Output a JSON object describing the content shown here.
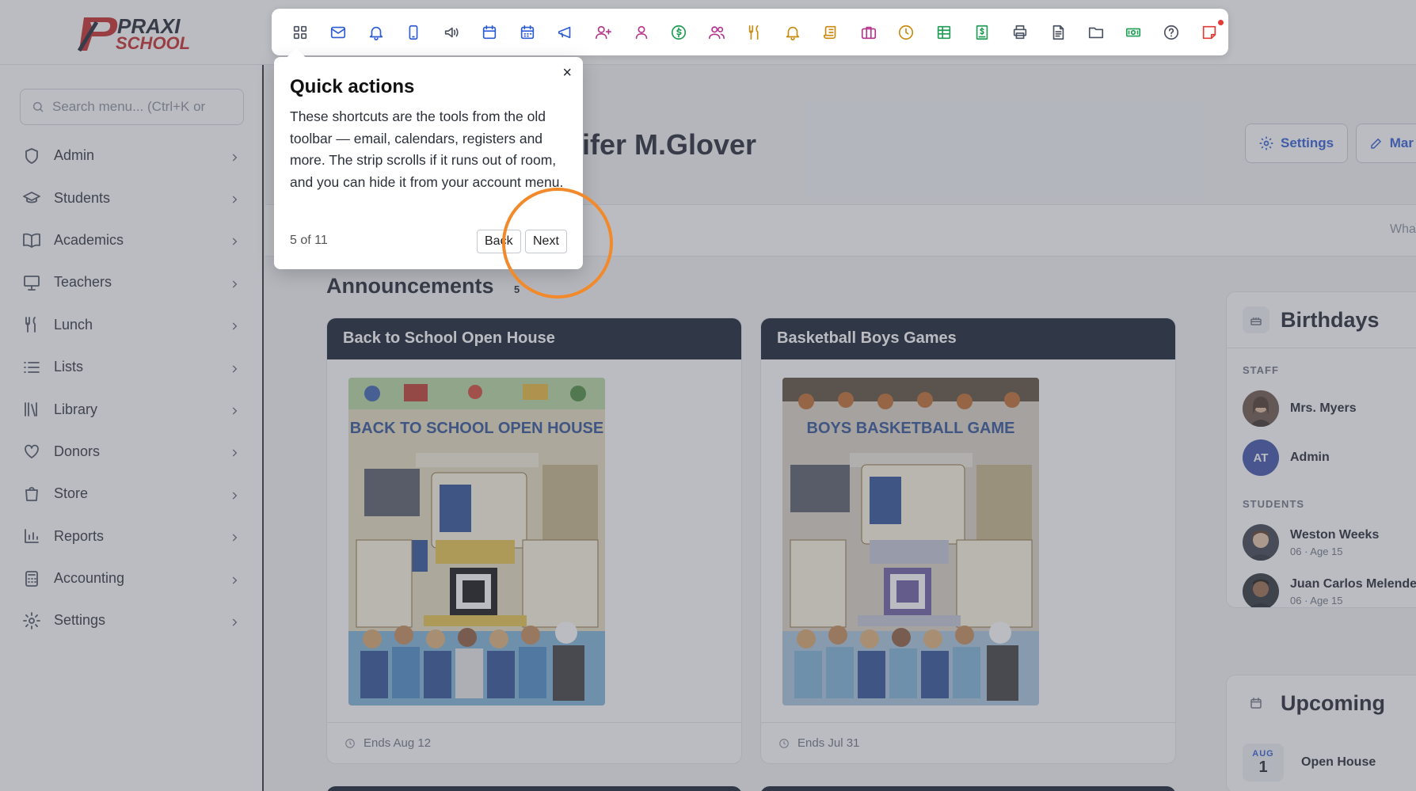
{
  "brand": {
    "line1": "PRAXI",
    "line2": "SCHOOL"
  },
  "sidebar": {
    "search_placeholder": "Search menu... (Ctrl+K or",
    "items": [
      {
        "label": "Admin",
        "icon": "shield-icon"
      },
      {
        "label": "Students",
        "icon": "graduation-cap-icon"
      },
      {
        "label": "Academics",
        "icon": "book-open-icon"
      },
      {
        "label": "Teachers",
        "icon": "presentation-icon"
      },
      {
        "label": "Lunch",
        "icon": "utensils-icon"
      },
      {
        "label": "Lists",
        "icon": "list-icon"
      },
      {
        "label": "Library",
        "icon": "library-icon"
      },
      {
        "label": "Donors",
        "icon": "heart-icon"
      },
      {
        "label": "Store",
        "icon": "shopping-bag-icon"
      },
      {
        "label": "Reports",
        "icon": "bar-chart-icon"
      },
      {
        "label": "Accounting",
        "icon": "calculator-icon"
      },
      {
        "label": "Settings",
        "icon": "gear-icon"
      }
    ]
  },
  "header": {
    "title_visible": "ifer M.Glover",
    "settings_label": "Settings",
    "manage_label": "Mar"
  },
  "tabs_hint": "Wha",
  "announcements": {
    "title": "Announcements",
    "count": "5",
    "cards": [
      {
        "title": "Back to School Open House",
        "ends": "Ends Aug 12",
        "poster_heading": "BACK TO SCHOOL OPEN HOUSE"
      },
      {
        "title": "Basketball Boys Games",
        "ends": "Ends Jul 31",
        "poster_heading": "BOYS BASKETBALL GAME"
      }
    ]
  },
  "birthdays": {
    "title": "Birthdays",
    "staff_label": "STAFF",
    "students_label": "STUDENTS",
    "staff": [
      {
        "name": "Mrs. Myers",
        "initials": ""
      },
      {
        "name": "Admin",
        "initials": "AT"
      }
    ],
    "students": [
      {
        "name": "Weston Weeks",
        "sub": "06 · Age 15"
      },
      {
        "name": "Juan Carlos Melendez",
        "sub": "06 · Age 15"
      }
    ]
  },
  "upcoming": {
    "title": "Upcoming",
    "items": [
      {
        "month": "AUG",
        "day": "1",
        "label": "Open House"
      }
    ]
  },
  "toolbar": {
    "buttons": [
      {
        "icon": "grid-icon",
        "color": "#4a5160"
      },
      {
        "icon": "mail-icon",
        "color": "#2d5bd6"
      },
      {
        "icon": "bell-icon",
        "color": "#2d5bd6"
      },
      {
        "icon": "tablet-icon",
        "color": "#2d5bd6"
      },
      {
        "icon": "megaphone-volume-icon",
        "color": "#4a5160"
      },
      {
        "icon": "calendar-icon",
        "color": "#2d5bd6"
      },
      {
        "icon": "calendar-days-icon",
        "color": "#2d5bd6"
      },
      {
        "icon": "announce-icon",
        "color": "#2d5bd6"
      },
      {
        "icon": "user-plus-icon",
        "color": "#b5338a"
      },
      {
        "icon": "user-icon",
        "color": "#b5338a"
      },
      {
        "icon": "dollar-circle-icon",
        "color": "#1f9d55"
      },
      {
        "icon": "users-icon",
        "color": "#b5338a"
      },
      {
        "icon": "utensils-icon",
        "color": "#c98a10"
      },
      {
        "icon": "bell-icon",
        "color": "#c98a10"
      },
      {
        "icon": "scroll-icon",
        "color": "#c98a10"
      },
      {
        "icon": "briefcase-icon",
        "color": "#b5338a"
      },
      {
        "icon": "clock-icon",
        "color": "#c98a10"
      },
      {
        "icon": "table-icon",
        "color": "#1f9d55"
      },
      {
        "icon": "invoice-dollar-icon",
        "color": "#1f9d55"
      },
      {
        "icon": "printer-icon",
        "color": "#4a5160"
      },
      {
        "icon": "file-text-icon",
        "color": "#4a5160"
      },
      {
        "icon": "folder-icon",
        "color": "#4a5160"
      },
      {
        "icon": "banknote-icon",
        "color": "#1f9d55"
      },
      {
        "icon": "help-circle-icon",
        "color": "#4a5160"
      },
      {
        "icon": "sticky-note-icon",
        "color": "#e53935"
      }
    ]
  },
  "tour": {
    "title": "Quick actions",
    "body": "These shortcuts are the tools from the old toolbar — email, calendars, registers and more. The strip scrolls if it runs out of room, and you can hide it from your account menu.",
    "progress": "5 of 11",
    "back_label": "Back",
    "next_label": "Next",
    "close_glyph": "×"
  },
  "colors": {
    "accent": "#2d5bd6",
    "dark_header": "#121a2c",
    "highlight_ring": "#f28a2b"
  }
}
